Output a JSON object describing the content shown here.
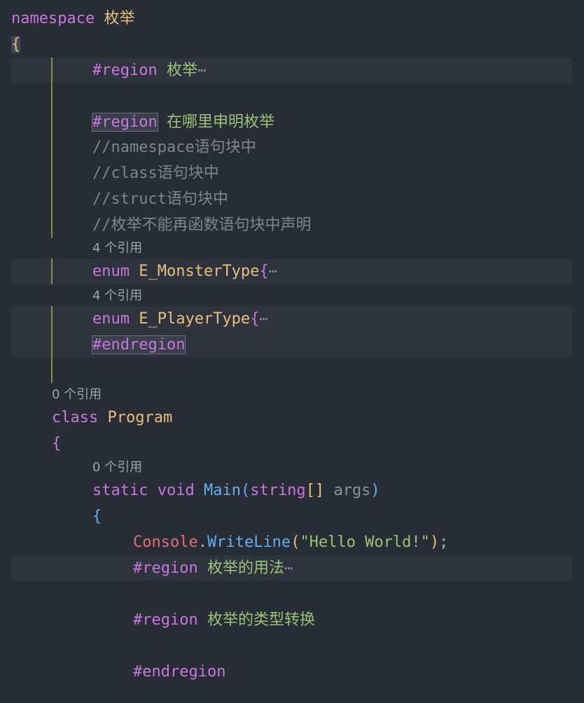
{
  "lines": {
    "l1_kw": "namespace",
    "l1_name": "枚举",
    "l2_brace": "{",
    "l3_kw": "#region",
    "l3_name": "枚举",
    "ellipsis": "⋯",
    "l5_kw": "#region",
    "l5_name": "在哪里申明枚举",
    "l6": "//namespace语句块中",
    "l7": "//class语句块中",
    "l8": "//struct语句块中",
    "l9": "//枚举不能再函数语句块中声明",
    "lens_4": "4 个引用",
    "l10_kw": "enum",
    "l10_name": "E_MonsterType",
    "l11_kw": "enum",
    "l11_name": "E_PlayerType",
    "l12_kw": "#endregion",
    "lens_0": "0 个引用",
    "l14_kw": "class",
    "l14_name": "Program",
    "open_brace": "{",
    "l16_static": "static",
    "l16_void": "void",
    "l16_main": "Main",
    "l16_paren_open": "(",
    "l16_string": "string",
    "l16_brackets": "[]",
    "l16_args": "args",
    "l16_paren_close": ")",
    "l18_console": "Console",
    "l18_dot": ".",
    "l18_write": "WriteLine",
    "l18_po": "(",
    "l18_str": "\"Hello World!\"",
    "l18_pc": ")",
    "l18_semi": ";",
    "l19_kw": "#region",
    "l19_name": "枚举的用法",
    "l20_kw": "#region",
    "l20_name": "枚举的类型转换",
    "l21_kw": "#endregion"
  }
}
